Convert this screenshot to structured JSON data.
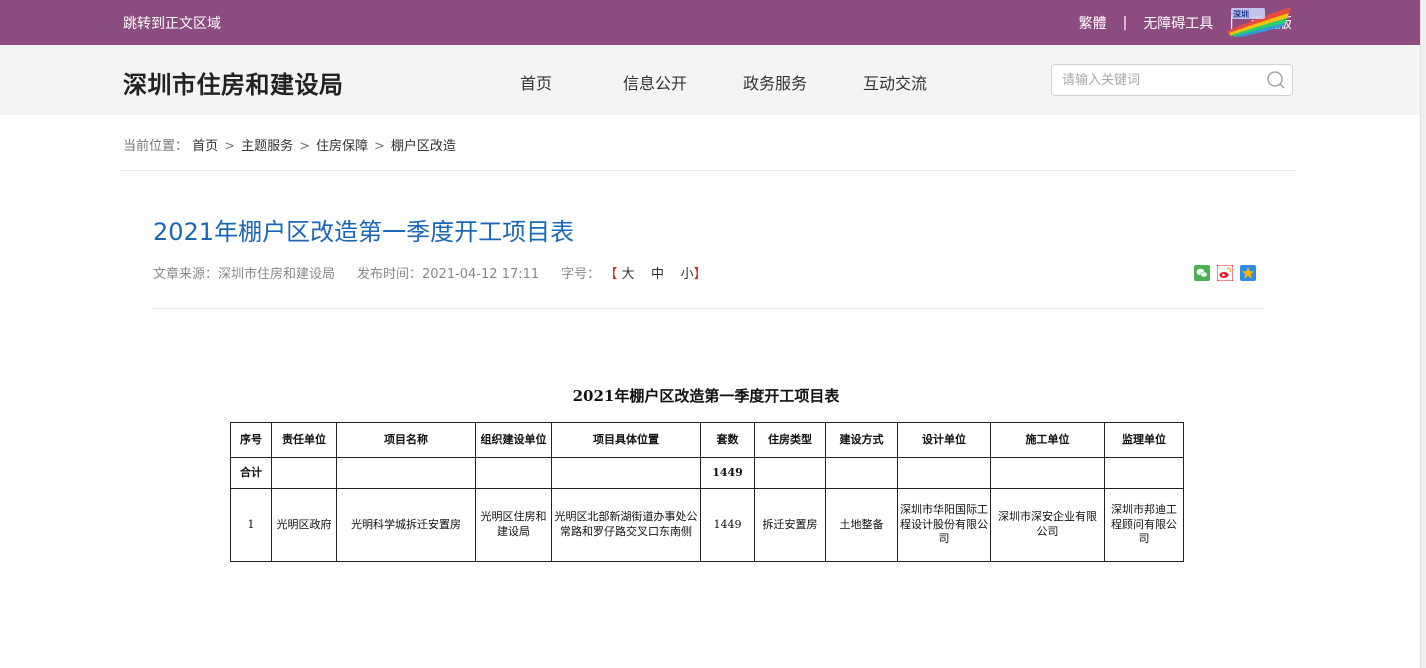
{
  "topbar": {
    "skip_link": "跳转到正文区域",
    "traditional": "繁體",
    "sep1": "|",
    "accessibility": "无障碍工具",
    "sep2": "|",
    "mobile": "手机版",
    "logo_icon": "shenzhen-gov-logo"
  },
  "header": {
    "site_title": "深圳市住房和建设局",
    "nav": [
      "首页",
      "信息公开",
      "政务服务",
      "互动交流"
    ],
    "search_placeholder": "请输入关键词",
    "search_icon": "search-icon"
  },
  "breadcrumb": {
    "label": "当前位置：",
    "items": [
      "首页",
      "主题服务",
      "住房保障",
      "棚户区改造"
    ],
    "separator": ">"
  },
  "article": {
    "title": "2021年棚户区改造第一季度开工项目表",
    "source": "文章来源：深圳市住房和建设局",
    "publish_time": "发布时间：2021-04-12 17:11",
    "font_size_label": "字号：",
    "font_open": "【",
    "font_large": "大",
    "font_medium": "中",
    "font_small": "小",
    "font_close": "】",
    "share_icons": [
      "wechat-icon",
      "weibo-icon",
      "qzone-icon"
    ],
    "share_colors": {
      "wechat": "#4caf50",
      "weibo": "#e6162d",
      "qzone": "#f5b400"
    }
  },
  "table": {
    "title": "2021年棚户区改造第一季度开工项目表",
    "headers": [
      "序号",
      "责任单位",
      "项目名称",
      "组织建设单位",
      "项目具体位置",
      "套数",
      "住房类型",
      "建设方式",
      "设计单位",
      "施工单位",
      "监理单位"
    ],
    "total_row": [
      "合计",
      "",
      "",
      "",
      "",
      "1449",
      "",
      "",
      "",
      "",
      ""
    ],
    "rows": [
      [
        "1",
        "光明区政府",
        "光明科学城拆迁安置房",
        "光明区住房和建设局",
        "光明区北部新湖街道办事处公常路和罗仔路交叉口东南侧",
        "1449",
        "拆迁安置房",
        "土地整备",
        "深圳市华阳国际工程设计股份有限公司",
        "深圳市深安企业有限公司",
        "深圳市邦迪工程顾问有限公司"
      ]
    ]
  },
  "colors": {
    "topbar_bg": "#8d4c7f",
    "header_bg": "#f4f4f4",
    "title_blue": "#1a67b7"
  }
}
